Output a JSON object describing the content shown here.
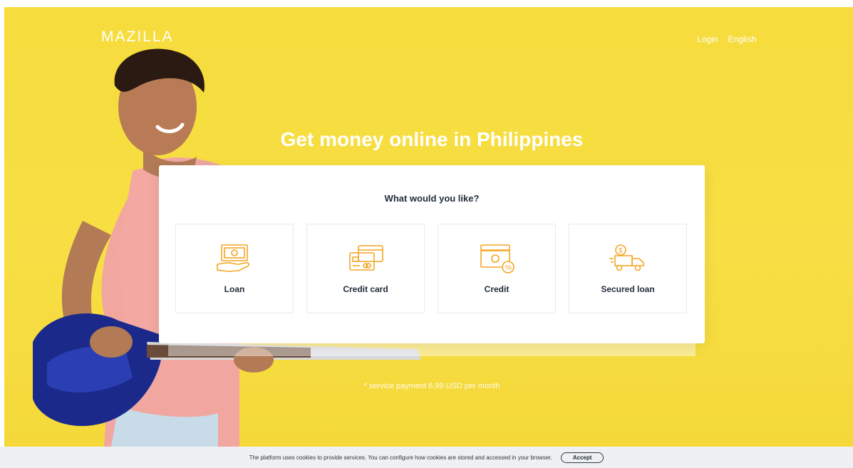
{
  "header": {
    "brand": "MAZILLA",
    "nav": [
      {
        "label": "Login"
      },
      {
        "label": "English"
      }
    ]
  },
  "hero": {
    "headline": "Get money online in Philippines",
    "note": "* service payment 6,99 USD per month"
  },
  "selector": {
    "title": "What would you like?",
    "options": [
      {
        "label": "Loan",
        "icon": "cash-hand-icon"
      },
      {
        "label": "Credit card",
        "icon": "credit-cards-icon"
      },
      {
        "label": "Credit",
        "icon": "cash-percent-icon"
      },
      {
        "label": "Secured loan",
        "icon": "truck-dollar-icon"
      }
    ]
  },
  "cookies": {
    "text": "The platform uses cookies to provide services. You can configure how cookies are stored and accessed in your browser.",
    "accept_label": "Accept"
  },
  "colors": {
    "background": "#f6dc3c",
    "icon_accent": "#f5a623",
    "card": "#ffffff",
    "cookie_bar": "#eef0f2"
  }
}
